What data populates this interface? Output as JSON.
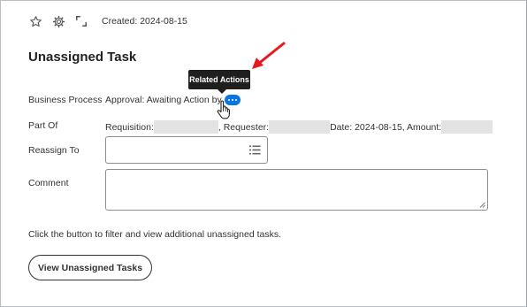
{
  "toolbar": {
    "icons": [
      "star-icon",
      "gear-icon",
      "expand-icon"
    ],
    "created": "Created: 2024-08-15"
  },
  "title": "Unassigned Task",
  "tooltip": "Related Actions",
  "fields": {
    "business_process": {
      "label": "Business Process",
      "value": "Approval: Awaiting Action by"
    },
    "part_of": {
      "label": "Part Of",
      "requisition": "Requisition:",
      "requester": ", Requester:",
      "date_amount": "Date: 2024-08-15, Amount:"
    },
    "reassign_to": {
      "label": "Reassign To",
      "value": ""
    },
    "comment": {
      "label": "Comment",
      "value": ""
    }
  },
  "hint": "Click the button to filter and view additional unassigned tasks.",
  "button": "View Unassigned Tasks",
  "colors": {
    "accent": "#0875e1",
    "annotation_arrow": "#e8191c",
    "tooltip_bg": "#1f1f1f"
  }
}
